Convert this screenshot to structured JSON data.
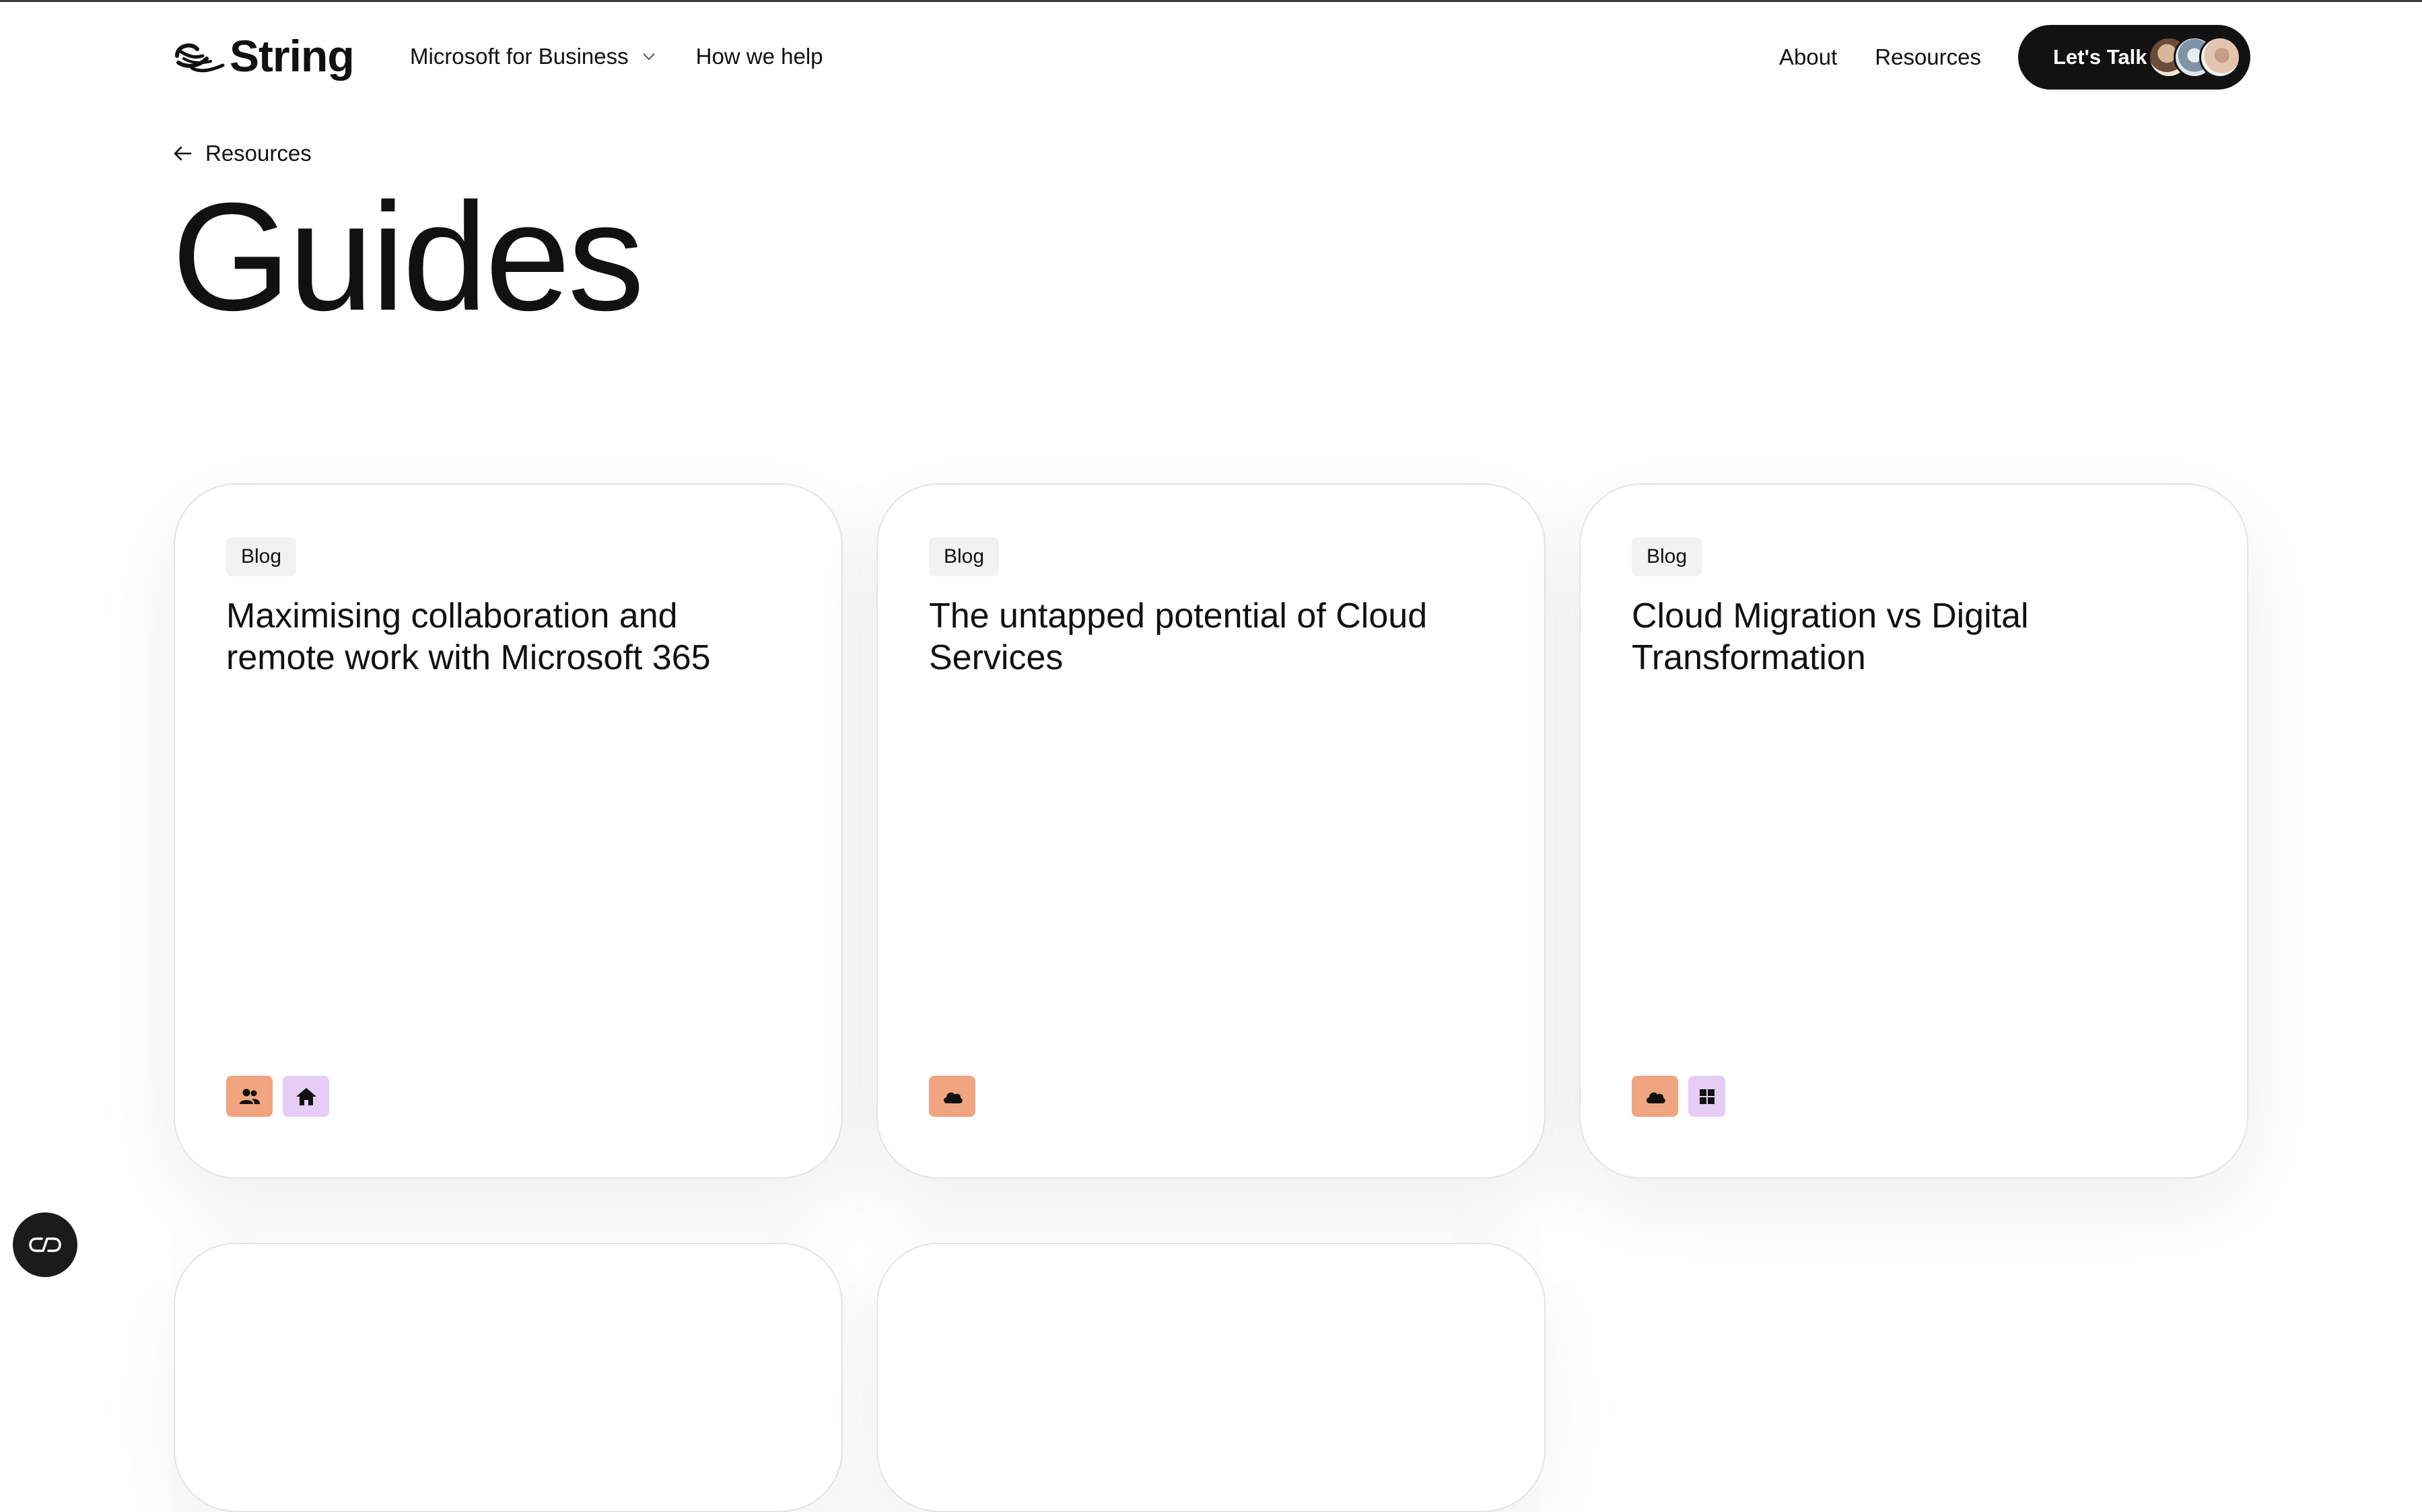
{
  "header": {
    "logo_text": "String",
    "nav_left": [
      "Microsoft for Business",
      "How we help"
    ],
    "nav_right": [
      "About",
      "Resources"
    ],
    "cta_label": "Let's Talk"
  },
  "breadcrumb": {
    "label": "Resources"
  },
  "page": {
    "title": "Guides"
  },
  "cards": [
    {
      "badge": "Blog",
      "title": "Maximising collaboration and remote work with Microsoft 365",
      "tags": [
        "people-icon",
        "home-icon"
      ]
    },
    {
      "badge": "Blog",
      "title": "The untapped potential of Cloud Services",
      "tags": [
        "cloud-icon"
      ]
    },
    {
      "badge": "Blog",
      "title": "Cloud Migration vs Digital Transformation",
      "tags": [
        "cloud-icon",
        "windows-icon"
      ]
    }
  ],
  "colors": {
    "tag_orange": "#f0a47f",
    "tag_purple": "#e6cdf6",
    "cta_bg": "#121212"
  }
}
